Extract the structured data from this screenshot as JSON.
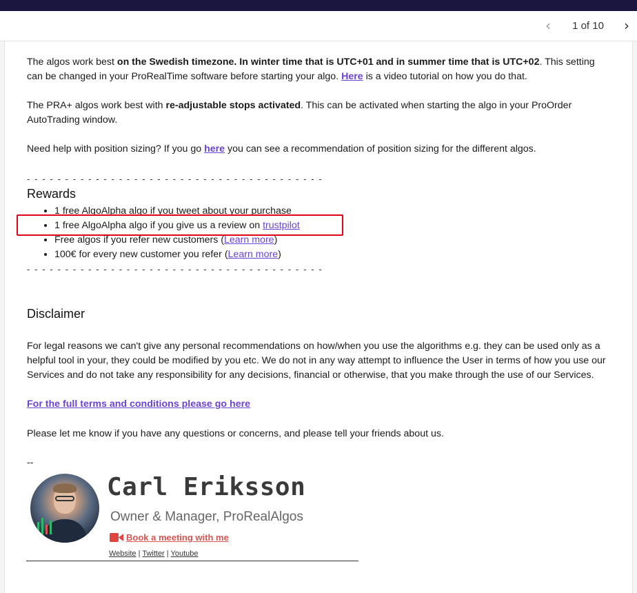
{
  "pager": {
    "prev_icon": "chevron-left-icon",
    "page_count": "1 of 10",
    "next_icon": "chevron-right-icon"
  },
  "email": {
    "para_timezone": {
      "t1": "The algos work best ",
      "b1": "on the Swedish timezone. In winter time that is UTC+01 and in summer time that is UTC+02",
      "t2": ". This setting can be changed in your ProRealTime software before starting your algo. ",
      "link": "Here",
      "t3": " is a video tutorial on how you do that."
    },
    "para_stops": {
      "t1": "The PRA+ algos work best with ",
      "b1": "re-adjustable stops activated",
      "t2": ". This can be activated when starting the algo in your ProOrder AutoTrading window."
    },
    "para_sizing": {
      "t1": "Need help with position sizing? If you go ",
      "link": "here",
      "t2": " you can see a recommendation of position sizing for the different algos."
    },
    "dashes": "- - - - - - - - - - - - - - - - - - - - - - - - - - - - - - - - - - - - - - -",
    "rewards_title": "Rewards",
    "rewards": [
      {
        "text": "1 free AlgoAlpha algo if you tweet about your purchase"
      },
      {
        "text": "1 free AlgoAlpha algo if you give us a review on ",
        "link": "trustpilot"
      },
      {
        "text": "Free algos if you refer new customers (",
        "link": "Learn more",
        "after": ")"
      },
      {
        "text": "100€ for every new customer you refer (",
        "link": "Learn more",
        "after": ")"
      }
    ],
    "disclaimer_title": "Disclaimer",
    "disclaimer_text": "For legal reasons we can't give any personal recommendations on how/when you use the algorithms e.g. they can be used only as a helpful tool in your, they could be modified by you etc. We do not in any way attempt to influence the User in terms of how you use our Services and do not take any responsibility for any decisions, financial or otherwise, that you make through the use of our Services.",
    "terms_link": "For the full terms and conditions please go here",
    "closing": "Please let me know if you have any questions or concerns, and please tell your friends about us.",
    "sig_sep": "--"
  },
  "signature": {
    "name": "Carl Eriksson",
    "role": "Owner & Manager, ProRealAlgos",
    "meeting_icon": "video-camera-icon",
    "meeting_link": "Book a meeting with me",
    "links": [
      "Website",
      "Twitter",
      "Youtube"
    ],
    "link_sep": " | ",
    "accent": "#d9534f"
  },
  "colors": {
    "link": "#6b42d6",
    "highlight": "#e0001a",
    "topbar": "#1b1640"
  }
}
